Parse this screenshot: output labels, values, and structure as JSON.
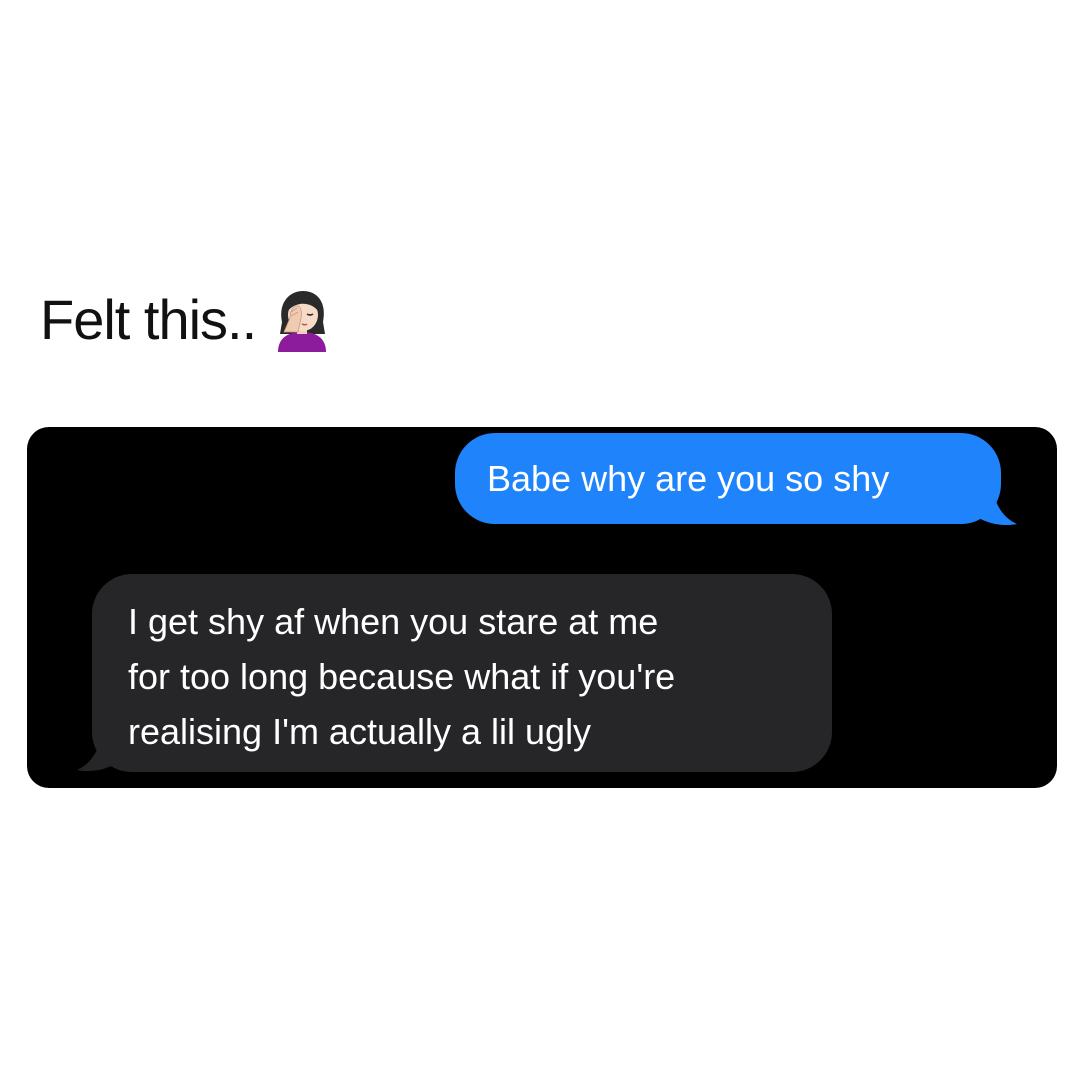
{
  "caption": {
    "text": "Felt this..",
    "emoji": "woman-facepalming-icon"
  },
  "conversation": {
    "background": "#000000",
    "messages": [
      {
        "direction": "outgoing",
        "text": "Babe why are you so shy",
        "color": "#1f83fb"
      },
      {
        "direction": "incoming",
        "lines": [
          "I get shy af when you stare at me",
          "for too long because what if you're",
          "realising I'm actually a lil ugly"
        ],
        "color": "#262628"
      }
    ]
  }
}
